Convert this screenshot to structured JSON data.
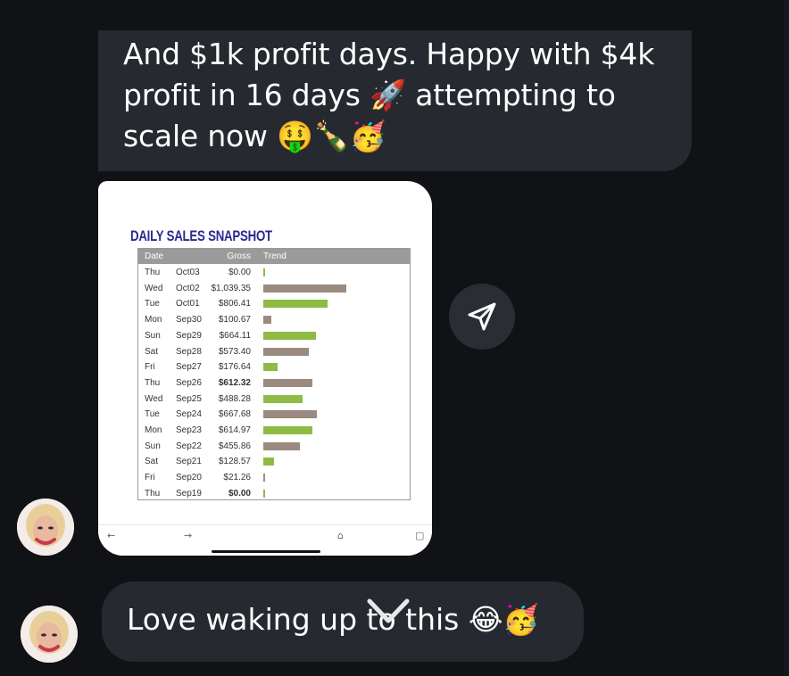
{
  "messages": {
    "top_text": "And $1k profit days. Happy with $4k profit in 16 days 🚀 attempting to scale now 🤑🍾🥳",
    "bottom_text": "Love waking up to this 😂🥳"
  },
  "attachment": {
    "title": "DAILY SALES SNAPSHOT",
    "headers": {
      "date": "Date",
      "gross": "Gross",
      "trend": "Trend"
    },
    "colors": {
      "green": "#8dbb44",
      "gray": "#9a8a80"
    },
    "rows": [
      {
        "day": "Thu",
        "date": "Oct03",
        "gross": "$0.00",
        "value": 0.0,
        "bold": false
      },
      {
        "day": "Wed",
        "date": "Oct02",
        "gross": "$1,039.35",
        "value": 1039.35,
        "bold": false
      },
      {
        "day": "Tue",
        "date": "Oct01",
        "gross": "$806.41",
        "value": 806.41,
        "bold": false
      },
      {
        "day": "Mon",
        "date": "Sep30",
        "gross": "$100.67",
        "value": 100.67,
        "bold": false
      },
      {
        "day": "Sun",
        "date": "Sep29",
        "gross": "$664.11",
        "value": 664.11,
        "bold": false
      },
      {
        "day": "Sat",
        "date": "Sep28",
        "gross": "$573.40",
        "value": 573.4,
        "bold": false
      },
      {
        "day": "Fri",
        "date": "Sep27",
        "gross": "$176.64",
        "value": 176.64,
        "bold": false
      },
      {
        "day": "Thu",
        "date": "Sep26",
        "gross": "$612.32",
        "value": 612.32,
        "bold": true
      },
      {
        "day": "Wed",
        "date": "Sep25",
        "gross": "$488.28",
        "value": 488.28,
        "bold": false
      },
      {
        "day": "Tue",
        "date": "Sep24",
        "gross": "$667.68",
        "value": 667.68,
        "bold": false
      },
      {
        "day": "Mon",
        "date": "Sep23",
        "gross": "$614.97",
        "value": 614.97,
        "bold": false
      },
      {
        "day": "Sun",
        "date": "Sep22",
        "gross": "$455.86",
        "value": 455.86,
        "bold": false
      },
      {
        "day": "Sat",
        "date": "Sep21",
        "gross": "$128.57",
        "value": 128.57,
        "bold": false
      },
      {
        "day": "Fri",
        "date": "Sep20",
        "gross": "$21.26",
        "value": 21.26,
        "bold": false
      },
      {
        "day": "Thu",
        "date": "Sep19",
        "gross": "$0.00",
        "value": 0.0,
        "bold": true
      }
    ],
    "nav": {
      "back_icon": "←",
      "forward_icon": "→",
      "home_icon": "⌂",
      "tabs_icon": "▢"
    }
  },
  "share_button": {
    "icon": "send-icon"
  },
  "theme": {
    "background": "#101216",
    "bubble": "#262a30",
    "text": "#ffffff"
  }
}
